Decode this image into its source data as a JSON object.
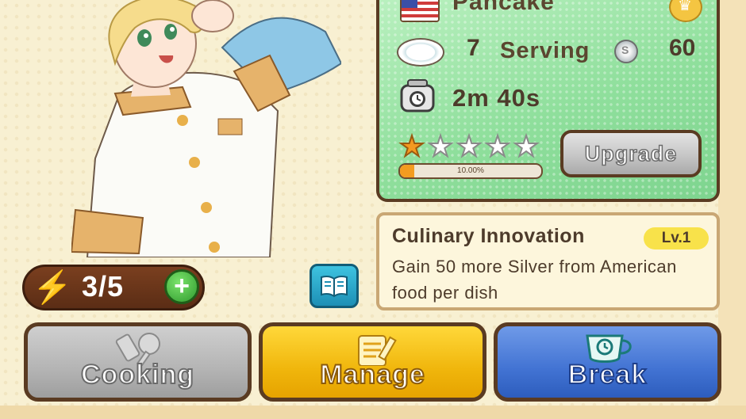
{
  "dish": {
    "name": "Pancake",
    "flag": "us-flag-icon",
    "serving_count": "7",
    "serving_label": "Serving",
    "silver_value": "60",
    "cook_time": "2m 40s",
    "stars_total": 5,
    "stars_filled": 1,
    "progress_label": "10.00%",
    "progress_fraction": 0.1,
    "upgrade_label": "Upgrade"
  },
  "skill": {
    "title": "Culinary Innovation",
    "level": "Lv.1",
    "description": "Gain 50 more Silver from American food per dish"
  },
  "energy": {
    "value": "3/5",
    "plus": "+"
  },
  "actions": {
    "cooking": "Cooking",
    "manage": "Manage",
    "break": "Break"
  },
  "colors": {
    "accent_orange": "#f39c20",
    "card_green": "#8fdf9c",
    "border_brown": "#5a3b22",
    "manage_yellow": "#f0b60c",
    "break_blue": "#4273d3"
  }
}
